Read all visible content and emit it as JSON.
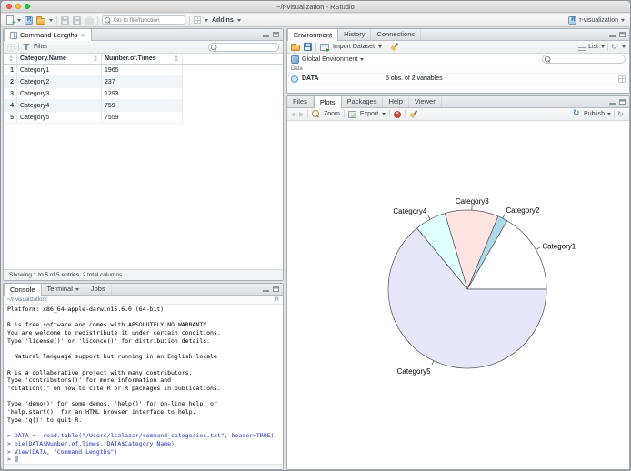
{
  "window": {
    "title": "~/r-visualization - RStudio"
  },
  "main_toolbar": {
    "goto_placeholder": "Go to file/function",
    "addins_label": "Addins",
    "project_name": "r-visualization"
  },
  "data_viewer": {
    "tab_title": "Command Lengths",
    "filter_label": "Filter",
    "columns": [
      "Category.Name",
      "Number.of.Times"
    ],
    "rows": [
      {
        "n": "1",
        "name": "Category1",
        "times": "1965"
      },
      {
        "n": "2",
        "name": "Category2",
        "times": "237"
      },
      {
        "n": "3",
        "name": "Category3",
        "times": "1293"
      },
      {
        "n": "4",
        "name": "Category4",
        "times": "759"
      },
      {
        "n": "5",
        "name": "Category5",
        "times": "7559"
      }
    ],
    "status": "Showing 1 to 5 of 5 entries, 2 total columns"
  },
  "console": {
    "tabs": [
      "Console",
      "Terminal",
      "Jobs"
    ],
    "working_dir": "~/r-visualization/",
    "command_color": "#2433CC",
    "lines": [
      {
        "type": "output",
        "text": "Platform: x86_64-apple-darwin15.6.0 (64-bit)"
      },
      {
        "type": "output",
        "text": ""
      },
      {
        "type": "output",
        "text": "R is free software and comes with ABSOLUTELY NO WARRANTY."
      },
      {
        "type": "output",
        "text": "You are welcome to redistribute it under certain conditions."
      },
      {
        "type": "output",
        "text": "Type 'license()' or 'licence()' for distribution details."
      },
      {
        "type": "output",
        "text": ""
      },
      {
        "type": "output",
        "text": "  Natural language support but running in an English locale"
      },
      {
        "type": "output",
        "text": ""
      },
      {
        "type": "output",
        "text": "R is a collaborative project with many contributors."
      },
      {
        "type": "output",
        "text": "Type 'contributors()' for more information and"
      },
      {
        "type": "output",
        "text": "'citation()' on how to cite R or R packages in publications."
      },
      {
        "type": "output",
        "text": ""
      },
      {
        "type": "output",
        "text": "Type 'demo()' for some demos, 'help()' for on-line help, or"
      },
      {
        "type": "output",
        "text": "'help.start()' for an HTML browser interface to help."
      },
      {
        "type": "output",
        "text": "Type 'q()' to quit R."
      },
      {
        "type": "output",
        "text": ""
      },
      {
        "type": "command",
        "text": "> DATA <- read.table(\"/Users/lsalazar/command_categories.txt\", header=TRUE)"
      },
      {
        "type": "command",
        "text": "> pie(DATA$Number.of.Times, DATA$Category.Name)"
      },
      {
        "type": "command",
        "text": "> View(DATA, \"Command Lengths\")"
      },
      {
        "type": "prompt",
        "text": "> "
      }
    ]
  },
  "environment": {
    "tabs": [
      "Environment",
      "History",
      "Connections"
    ],
    "import_label": "Import Dataset",
    "list_label": "List",
    "scope_label": "Global Environment",
    "section_label": "Data",
    "objects": [
      {
        "name": "DATA",
        "summary": "5 obs. of 2 variables"
      }
    ]
  },
  "plots": {
    "tabs": [
      "Files",
      "Plots",
      "Packages",
      "Help",
      "Viewer"
    ],
    "zoom_label": "Zoom",
    "export_label": "Export",
    "publish_label": "Publish"
  },
  "chart_data": {
    "type": "pie",
    "title": "",
    "categories": [
      "Category1",
      "Category2",
      "Category3",
      "Category4",
      "Category5"
    ],
    "values": [
      1965,
      237,
      1293,
      759,
      7559
    ],
    "colors": [
      "#FFFFFF",
      "#ADD8E6",
      "#FFE4E1",
      "#E0FFFF",
      "#E6E6FA"
    ],
    "start_angle_deg": 0,
    "direction": "counterclockwise",
    "stroke_color": "#52525c",
    "label_color": "#000000",
    "legend": "none"
  }
}
